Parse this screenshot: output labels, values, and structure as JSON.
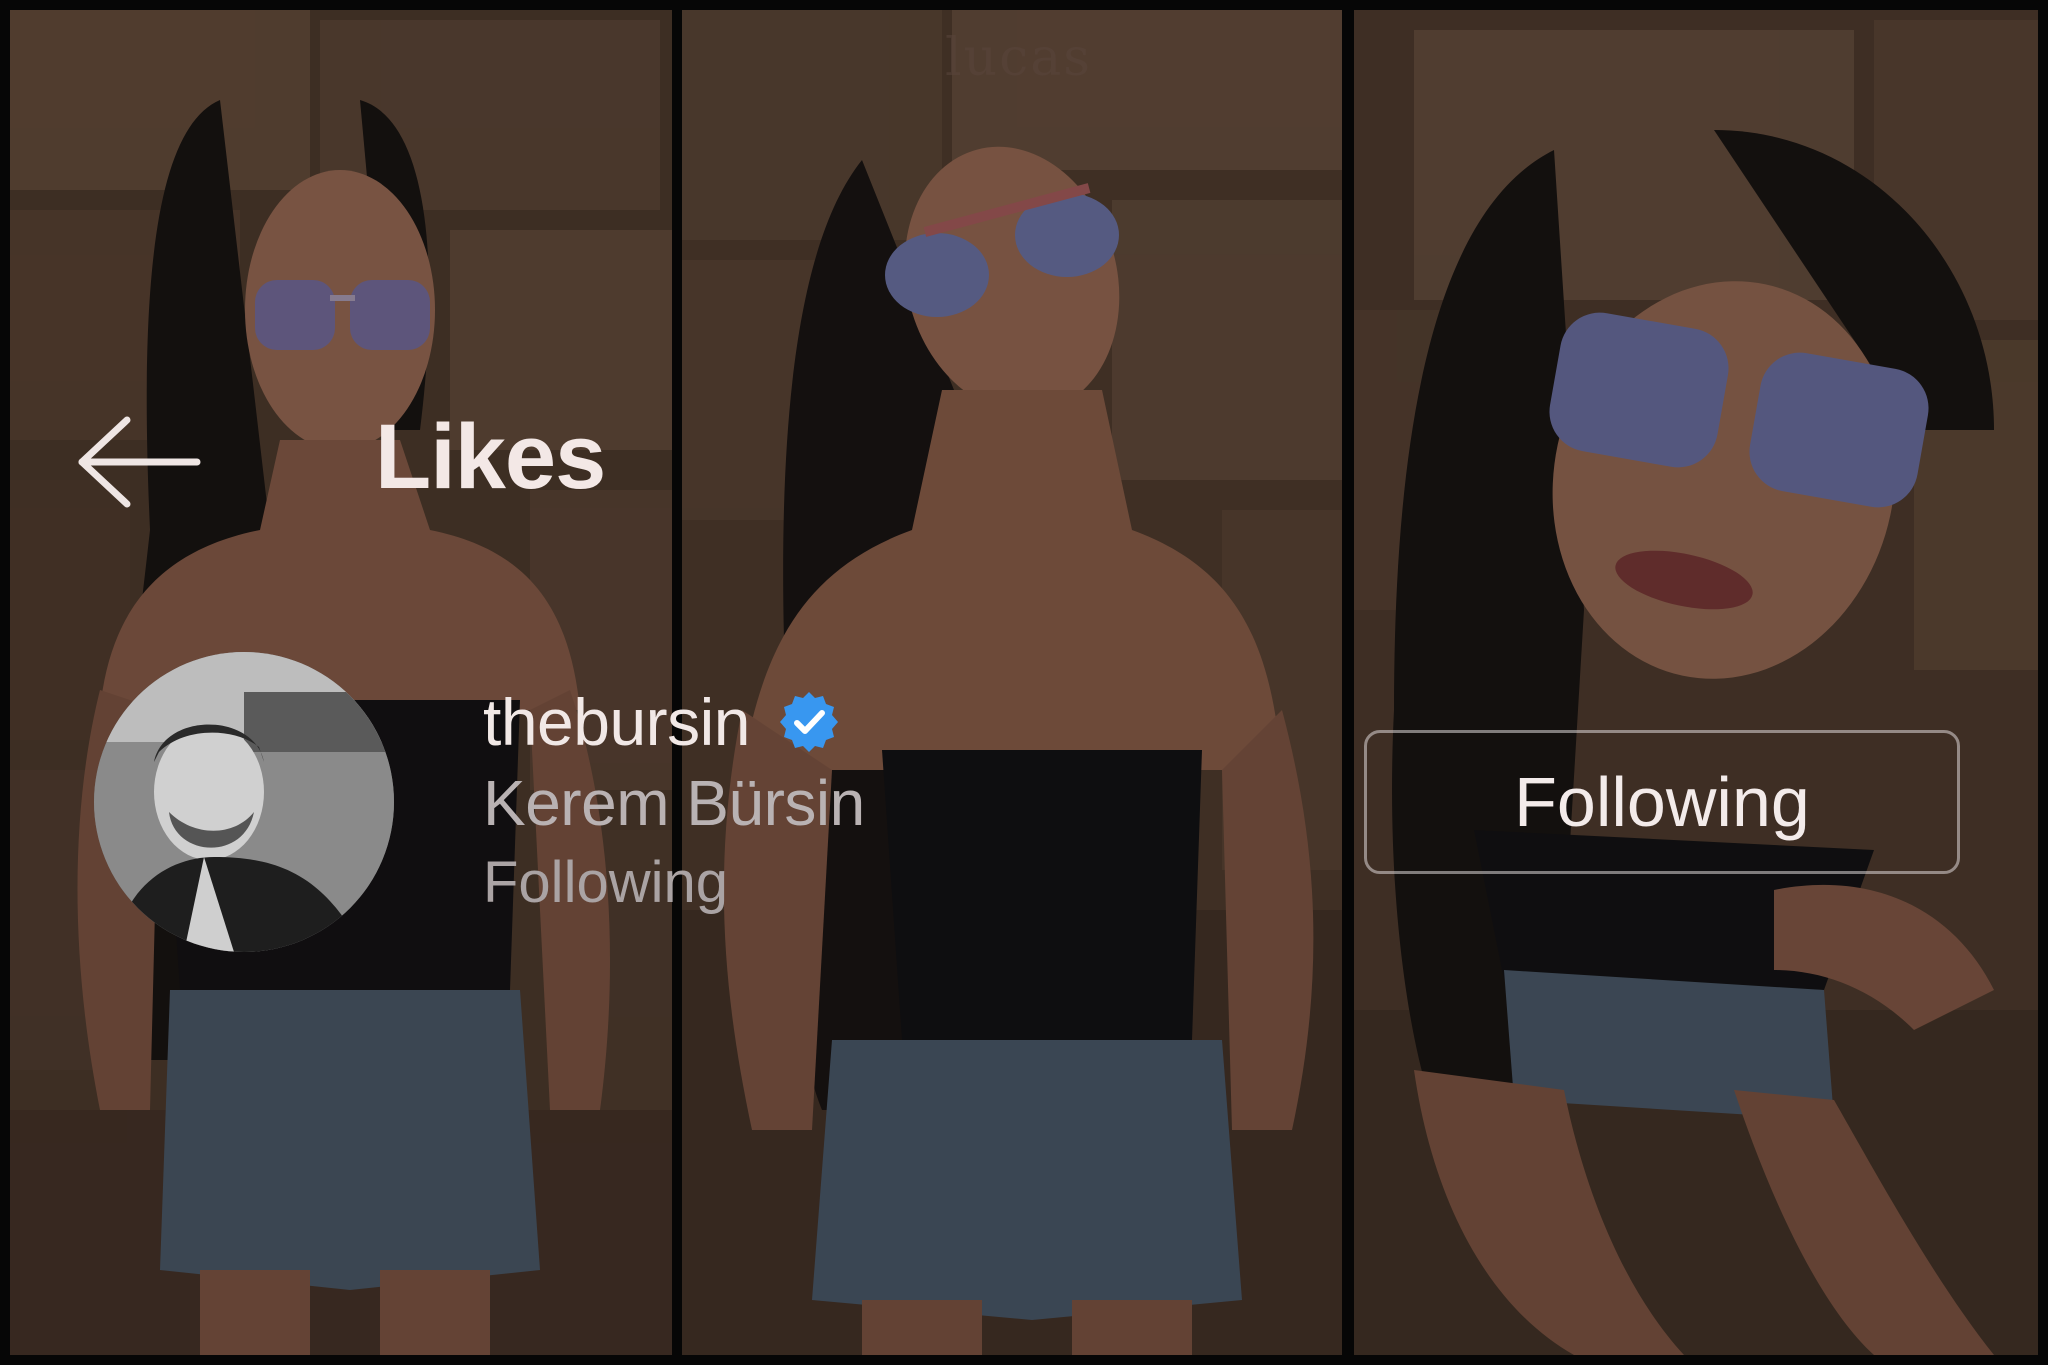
{
  "header": {
    "back_icon": "arrow-left-icon",
    "title": "Likes"
  },
  "watermark": "lucas",
  "user": {
    "username": "thebursin",
    "verified_icon": "verified-badge-icon",
    "full_name": "Kerem Bürsin",
    "status": "Following"
  },
  "action": {
    "following_label": "Following"
  },
  "colors": {
    "verified": "#3897f0",
    "text_primary": "#f1e8e6",
    "text_secondary": "#b9b2b3"
  }
}
